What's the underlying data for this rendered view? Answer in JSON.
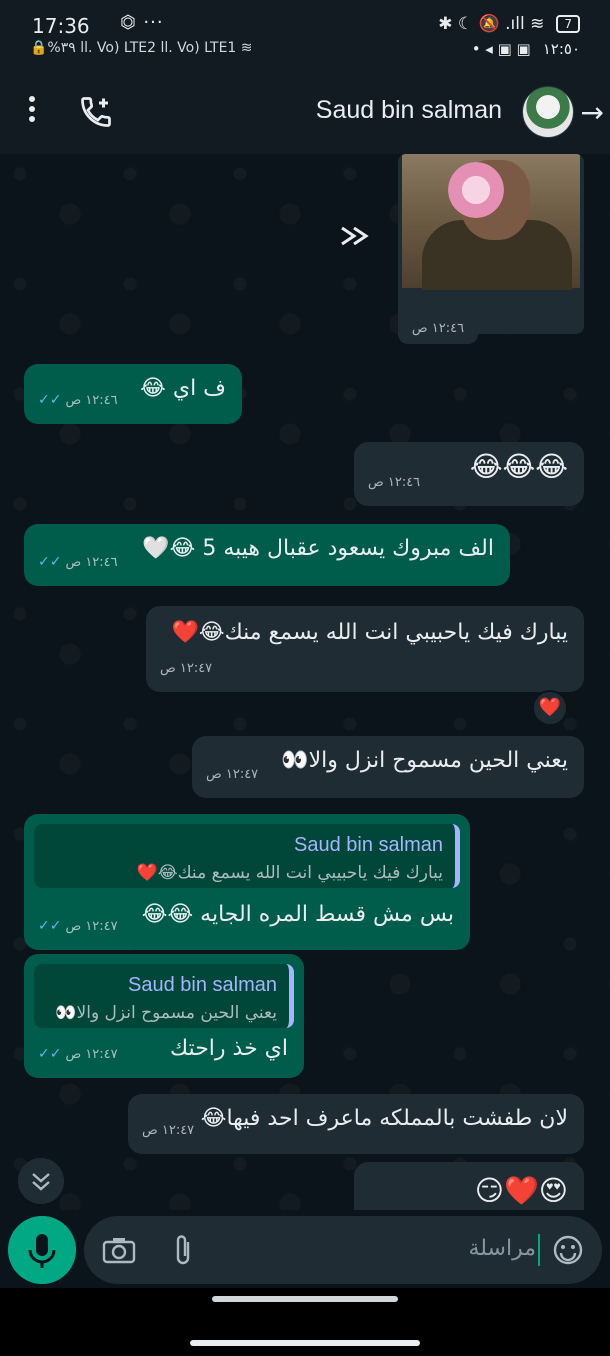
{
  "status_bar": {
    "time": "17:36",
    "extra": "⏣ ···",
    "line2": "🔒%٣٩ ⅼl. Vo) LTE2 ⅼl. Vo) LTE1 ≋",
    "icons_right": "✱ ☾ 🔕 .ıll ≋",
    "battery": "7",
    "time_arabic": "١٢:٥٠",
    "notif_icons": "• ◂ ▣ ▣"
  },
  "header": {
    "contact_name": "Saud bin salman"
  },
  "messages": [
    {
      "id": "m1",
      "type": "media",
      "direction": "in",
      "time": "١٢:٤٦ ص"
    },
    {
      "id": "m2",
      "direction": "out",
      "text": "ف اي 😂",
      "time": "١٢:٤٦ ص"
    },
    {
      "id": "m3",
      "direction": "in",
      "text": "😂😂😂",
      "time": "١٢:٤٦ ص"
    },
    {
      "id": "m4",
      "direction": "out",
      "text": "الف مبروك يسعود عقبال هيبه 5 😂🤍",
      "time": "١٢:٤٦ ص"
    },
    {
      "id": "m5",
      "direction": "in",
      "text": "يبارك فيك ياحبيبي انت الله يسمع منك😂❤️",
      "time": "١٢:٤٧ ص",
      "reaction": "❤️"
    },
    {
      "id": "m6",
      "direction": "in",
      "text": "يعني الحين مسموح انزل والا👀",
      "time": "١٢:٤٧ ص"
    },
    {
      "id": "m7",
      "direction": "out",
      "quote_name": "Saud bin salman",
      "quote_text": "يبارك فيك ياحبيبي انت الله يسمع منك😂❤️",
      "text": "بس مش قسط المره الجايه 😂😂",
      "time": "١٢:٤٧ ص"
    },
    {
      "id": "m8",
      "direction": "out",
      "quote_name": "Saud bin salman",
      "quote_text": "يعني الحين مسموح انزل والا👀",
      "text": "اي خذ راحتك",
      "time": "١٢:٤٧ ص"
    },
    {
      "id": "m9",
      "direction": "in",
      "text": "لان طفشت بالمملكه ماعرف احد فيها😂",
      "time": "١٢:٤٧ ص"
    },
    {
      "id": "m10",
      "direction": "in",
      "text": "😍❤️😏"
    }
  ],
  "input": {
    "placeholder": "مراسلة"
  },
  "colors": {
    "bg": "#0b141a",
    "bubble_out": "#005c4b",
    "bubble_in": "#202c33",
    "accent": "#00a884",
    "quote_name": "#a5b4fc",
    "read_ticks": "#53bdeb"
  },
  "icons": [
    "more-vert-icon",
    "add-call-icon",
    "back-arrow-icon",
    "forward-icon",
    "scroll-down-icon",
    "mic-icon",
    "camera-icon",
    "attach-icon",
    "emoji-icon"
  ]
}
